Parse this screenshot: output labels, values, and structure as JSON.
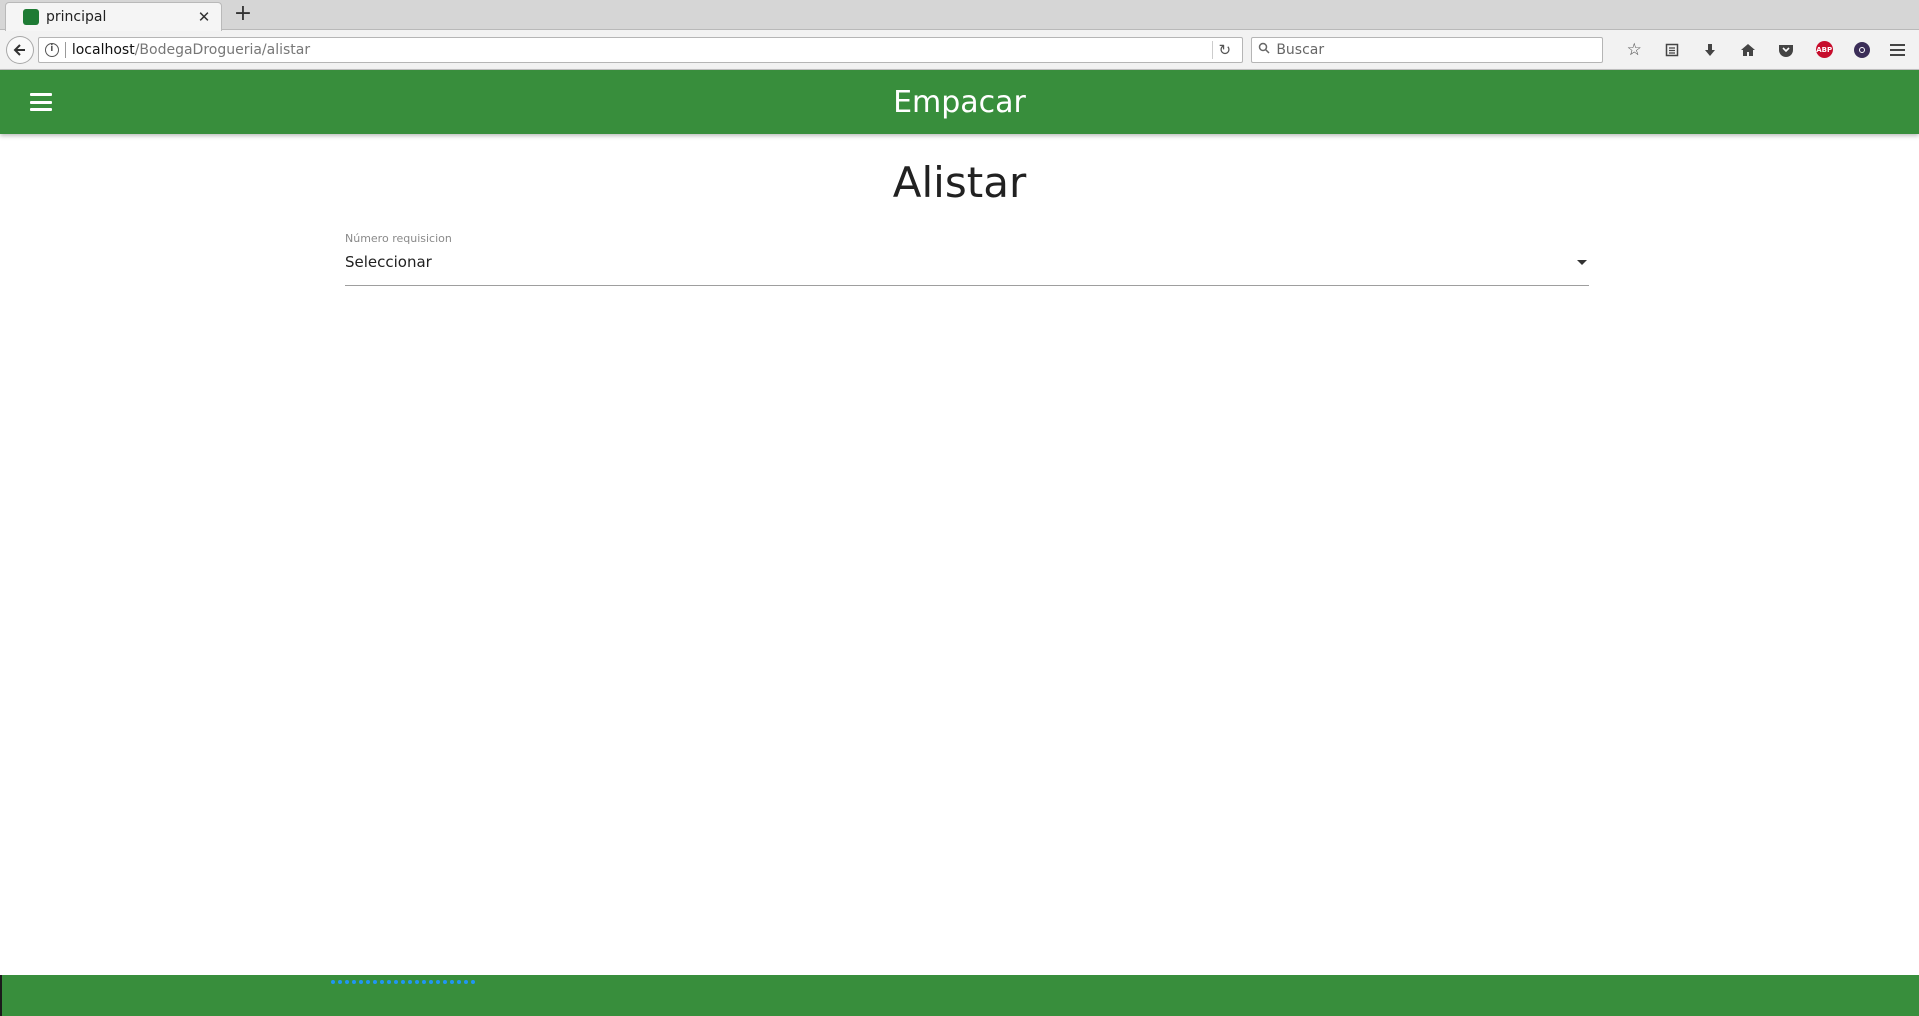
{
  "browser": {
    "tab_title": "principal",
    "tab_close": "✕",
    "new_tab": "+",
    "url_host": "localhost",
    "url_path": "/BodegaDrogueria/alistar",
    "search_placeholder": "Buscar",
    "toolbar_icons": [
      "bookmark-star-icon",
      "reading-list-icon",
      "download-icon",
      "home-icon",
      "pocket-icon",
      "adblock-icon",
      "extension-icon",
      "menu-icon"
    ],
    "abp_label": "ABP"
  },
  "app": {
    "title": "Empacar",
    "accent_color": "#388e3c"
  },
  "page": {
    "heading": "Alistar",
    "field_label": "Número requisicion",
    "select_value": "Seleccionar"
  }
}
